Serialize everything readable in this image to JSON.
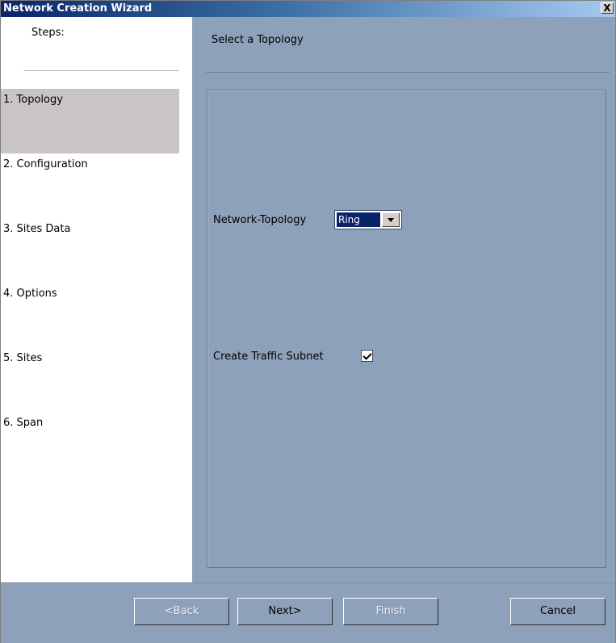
{
  "window": {
    "title": "Network Creation Wizard",
    "close_label": "X"
  },
  "steps": {
    "heading": "Steps:",
    "items": [
      {
        "label": "1. Topology",
        "active": true
      },
      {
        "label": "2. Configuration"
      },
      {
        "label": "3. Sites Data"
      },
      {
        "label": "4. Options"
      },
      {
        "label": "5. Sites"
      },
      {
        "label": "6. Span"
      }
    ]
  },
  "page": {
    "heading": "Select a Topology"
  },
  "form": {
    "topology_label": "Network-Topology",
    "topology_value": "Ring",
    "traffic_subnet_label": "Create Traffic Subnet",
    "traffic_subnet_checked": true
  },
  "footer": {
    "back_label": "<Back",
    "next_label": "Next>",
    "finish_label": "Finish",
    "cancel_label": "Cancel"
  },
  "colors": {
    "title_start": "#0a246a",
    "panel_background": "#8ea1ba",
    "active_step": "#c8c4c8"
  }
}
